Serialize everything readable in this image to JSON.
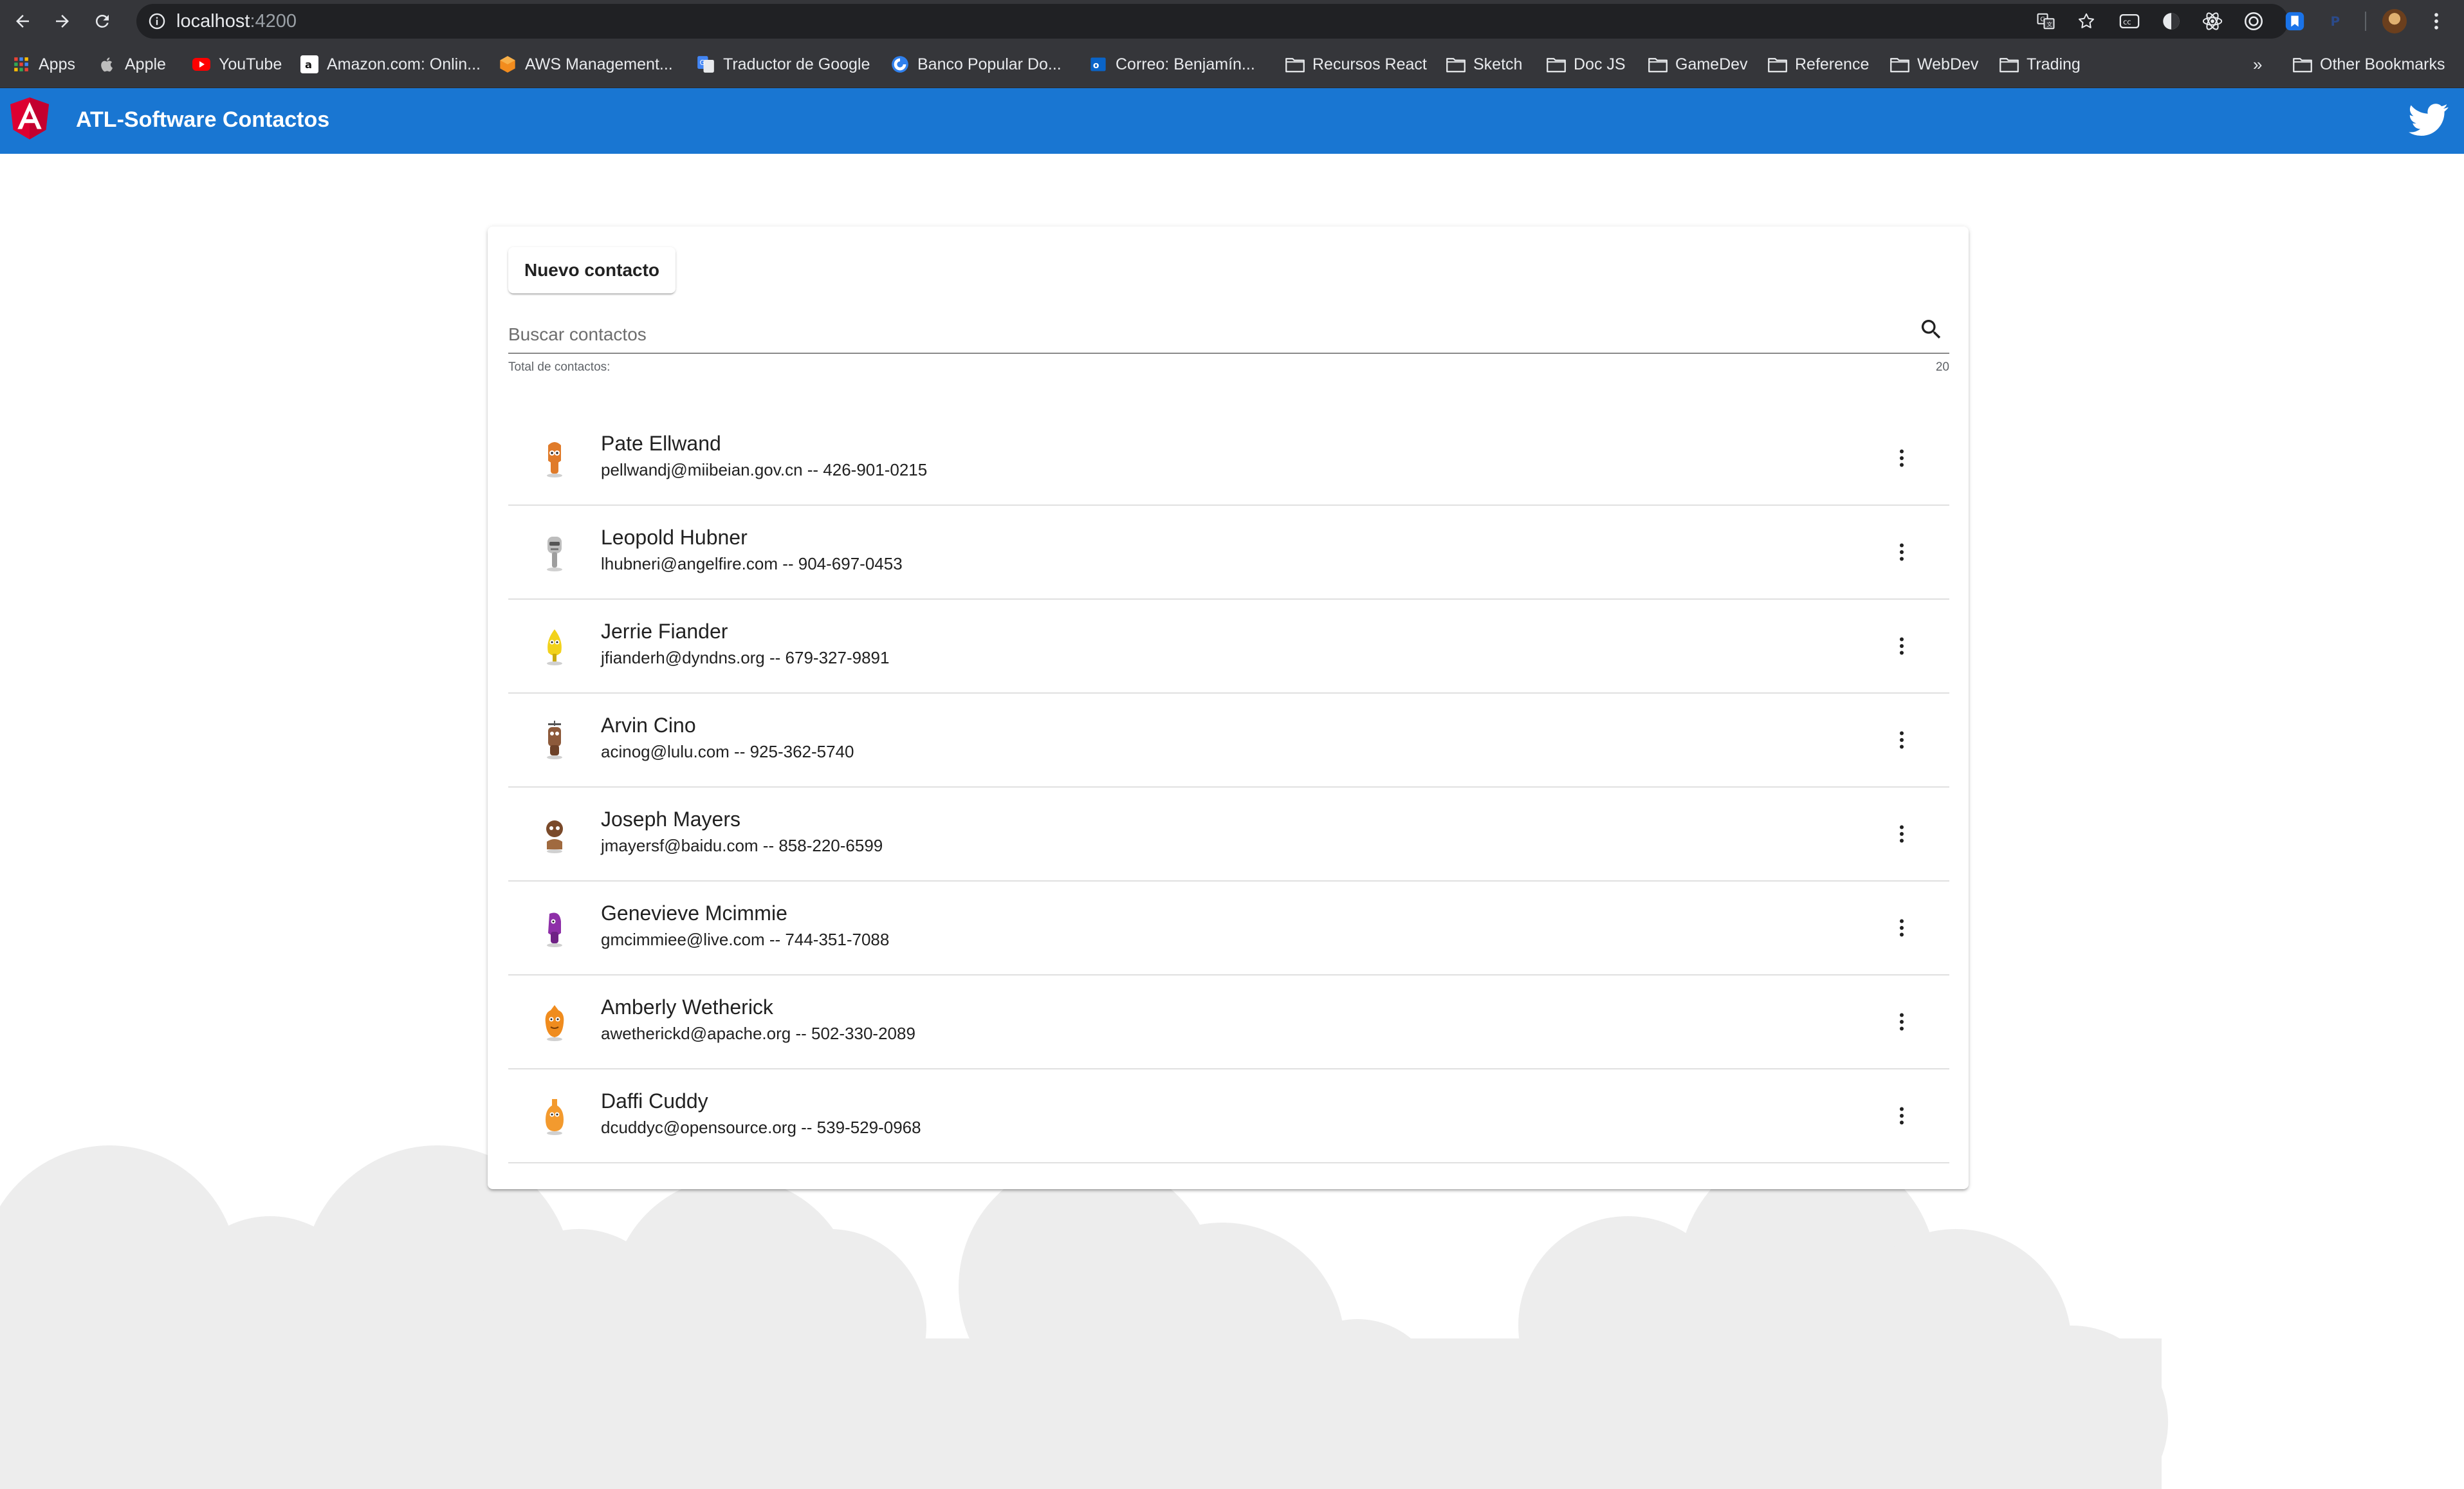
{
  "browser": {
    "url_host": "localhost",
    "url_port": ":4200",
    "bookmarks": [
      {
        "label": "Apps",
        "icon": "apps-grid-icon"
      },
      {
        "label": "Apple",
        "icon": "apple-icon"
      },
      {
        "label": "YouTube",
        "icon": "youtube-icon"
      },
      {
        "label": "Amazon.com: Onlin...",
        "icon": "amazon-icon"
      },
      {
        "label": "AWS Management...",
        "icon": "aws-icon"
      },
      {
        "label": "Traductor de Google",
        "icon": "google-translate-icon"
      },
      {
        "label": "Banco Popular Do...",
        "icon": "bank-icon"
      },
      {
        "label": "Correo: Benjamín...",
        "icon": "outlook-icon"
      },
      {
        "label": "Recursos React",
        "icon": "folder-icon"
      },
      {
        "label": "Sketch",
        "icon": "folder-icon"
      },
      {
        "label": "Doc JS",
        "icon": "folder-icon"
      },
      {
        "label": "GameDev",
        "icon": "folder-icon"
      },
      {
        "label": "Reference",
        "icon": "folder-icon"
      },
      {
        "label": "WebDev",
        "icon": "folder-icon"
      },
      {
        "label": "Trading",
        "icon": "folder-icon"
      }
    ],
    "overflow": "»",
    "other_bookmarks": "Other Bookmarks"
  },
  "toolbar": {
    "title": "ATL-Software Contactos"
  },
  "actions": {
    "new_contact": "Nuevo contacto"
  },
  "search": {
    "placeholder": "Buscar contactos",
    "value": ""
  },
  "summary": {
    "total_label": "Total de contactos:",
    "total_count": "20"
  },
  "contacts": [
    {
      "name": "Pate Ellwand",
      "detail": "pellwandj@miibeian.gov.cn -- 426-901-0215",
      "color": "#e07b2a"
    },
    {
      "name": "Leopold Hubner",
      "detail": "lhubneri@angelfire.com -- 904-697-0453",
      "color": "#bdbdbd"
    },
    {
      "name": "Jerrie Fiander",
      "detail": "jfianderh@dyndns.org -- 679-327-9891",
      "color": "#f2d21b"
    },
    {
      "name": "Arvin Cino",
      "detail": "acinog@lulu.com -- 925-362-5740",
      "color": "#8d5a3b"
    },
    {
      "name": "Joseph Mayers",
      "detail": "jmayersf@baidu.com -- 858-220-6599",
      "color": "#7a4a2a"
    },
    {
      "name": "Genevieve Mcimmie",
      "detail": "gmcimmiee@live.com -- 744-351-7088",
      "color": "#8e2fa8"
    },
    {
      "name": "Amberly Wetherick",
      "detail": "awetherickd@apache.org -- 502-330-2089",
      "color": "#f08c1e"
    },
    {
      "name": "Daffi Cuddy",
      "detail": "dcuddyc@opensource.org -- 539-529-0968",
      "color": "#f39a2e"
    }
  ],
  "colors": {
    "toolbar_blue": "#1976d2",
    "cloud_gray": "#ededed",
    "chrome_dark": "#35363a"
  }
}
